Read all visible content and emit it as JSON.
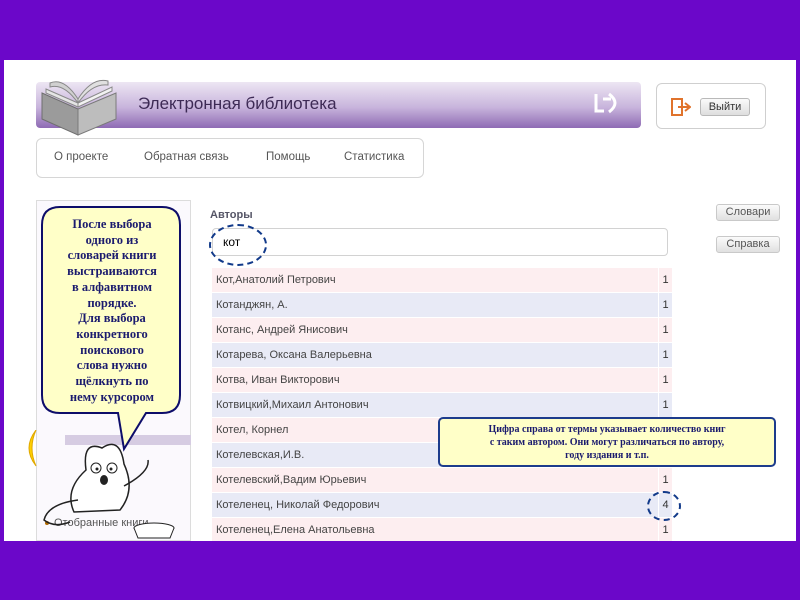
{
  "header": {
    "title": "Электронная библиотека",
    "logo_text": "ЭБ"
  },
  "exit": {
    "label": "Выйти"
  },
  "nav": {
    "items": [
      "О проекте",
      "Обратная связь",
      "Помощь",
      "Статистика"
    ]
  },
  "authors": {
    "heading": "Авторы",
    "search_value": "кот"
  },
  "side_buttons": {
    "dictionaries": "Словари",
    "help": "Справка"
  },
  "rows": [
    {
      "name": "Кот,Анатолий Петрович",
      "count": "1"
    },
    {
      "name": "Котанджян, А.",
      "count": "1"
    },
    {
      "name": "Котанс, Андрей Янисович",
      "count": "1"
    },
    {
      "name": "Котарева, Оксана Валерьевна",
      "count": "1"
    },
    {
      "name": "Котва, Иван Викторович",
      "count": "1"
    },
    {
      "name": "Котвицкий,Михаил Антонович",
      "count": "1"
    },
    {
      "name": "Котел, Корнел",
      "count": ""
    },
    {
      "name": "Котелевская,И.В.",
      "count": ""
    },
    {
      "name": "Котелевский,Вадим Юрьевич",
      "count": "1"
    },
    {
      "name": "Котеленец, Николай Федорович",
      "count": "4"
    },
    {
      "name": "Котеленец,Елена Анатольевна",
      "count": "1"
    }
  ],
  "sidebar": {
    "item_label": "Отобранные книги"
  },
  "callouts": {
    "bubble_lines": [
      "После выбора",
      "одного из",
      "словарей книги",
      "выстраиваются",
      "в алфавитном",
      "порядке.",
      "Для выбора",
      "конкретного",
      "поискового",
      "слова нужно",
      "щёлкнуть по",
      "нему курсором"
    ],
    "note_lines": [
      "Цифра справа от термы указывает количество книг",
      "с таким автором. Они могут различаться по автору,",
      "году издания и т.п."
    ]
  },
  "colors": {
    "slide_background": "#6b07c9",
    "highlight": "#123a8a",
    "note_bg": "#ffffc8"
  }
}
